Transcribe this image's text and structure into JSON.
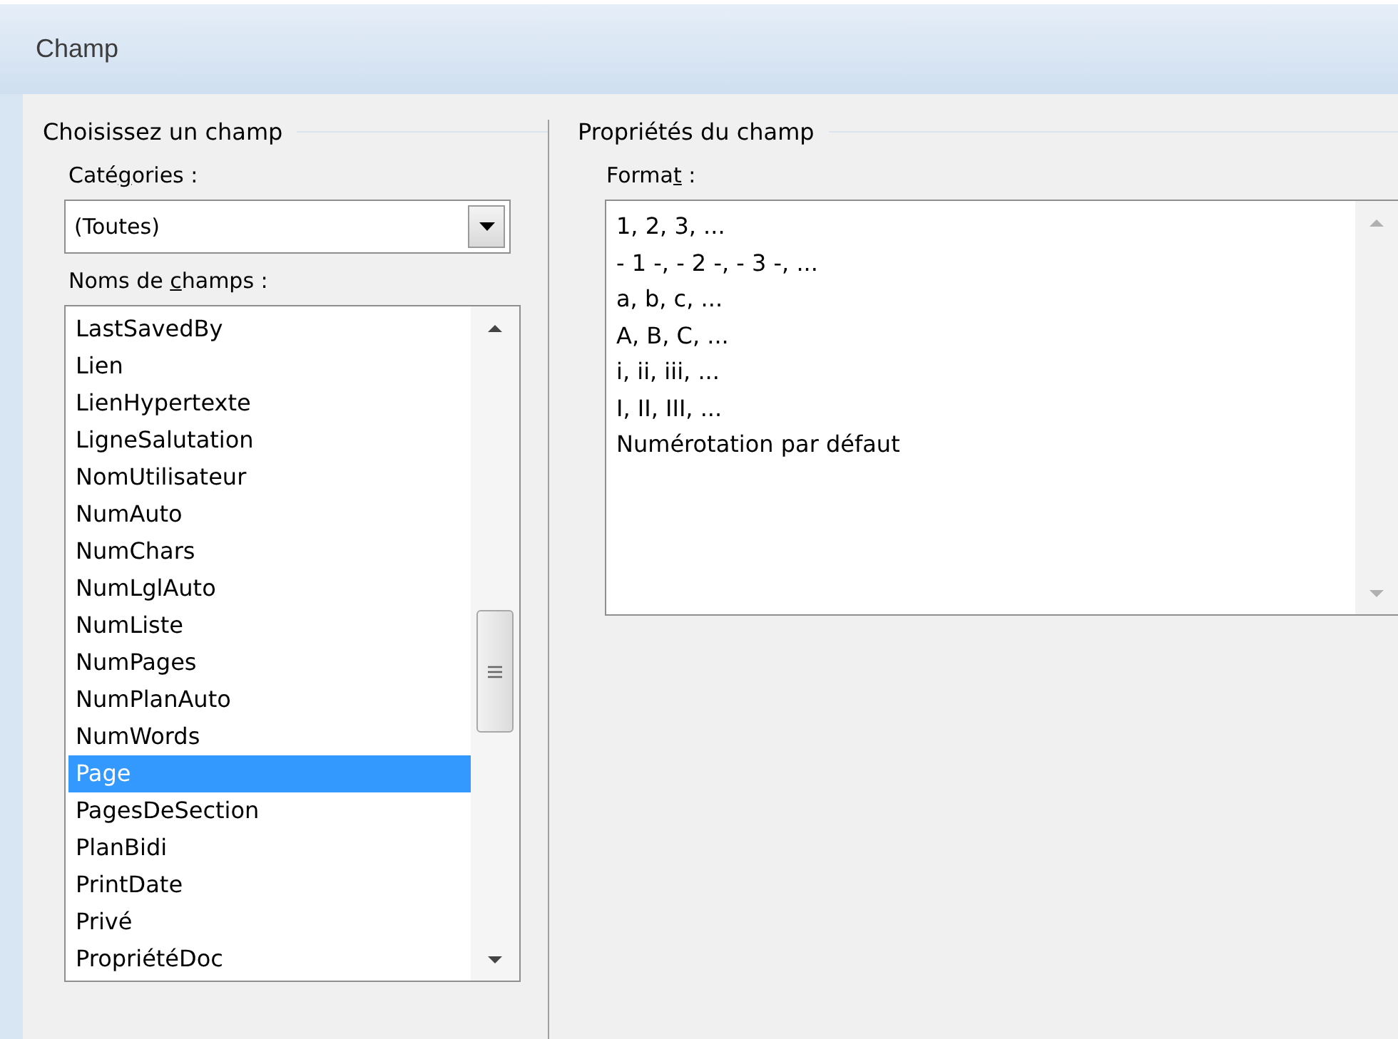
{
  "window": {
    "title": "Champ"
  },
  "left_group": {
    "title": "Choisissez un champ",
    "categories": {
      "label_parts": [
        "Caté",
        "g",
        "ories :"
      ],
      "value": "(Toutes)"
    },
    "field_names": {
      "label_parts": [
        "Noms de ",
        "c",
        "hamps :"
      ],
      "items": [
        {
          "label": "LastSavedBy",
          "selected": false
        },
        {
          "label": "Lien",
          "selected": false
        },
        {
          "label": "LienHypertexte",
          "selected": false
        },
        {
          "label": "LigneSalutation",
          "selected": false
        },
        {
          "label": "NomUtilisateur",
          "selected": false
        },
        {
          "label": "NumAuto",
          "selected": false
        },
        {
          "label": "NumChars",
          "selected": false
        },
        {
          "label": "NumLglAuto",
          "selected": false
        },
        {
          "label": "NumListe",
          "selected": false
        },
        {
          "label": "NumPages",
          "selected": false
        },
        {
          "label": "NumPlanAuto",
          "selected": false
        },
        {
          "label": "NumWords",
          "selected": false
        },
        {
          "label": "Page",
          "selected": true
        },
        {
          "label": "PagesDeSection",
          "selected": false
        },
        {
          "label": "PlanBidi",
          "selected": false
        },
        {
          "label": "PrintDate",
          "selected": false
        },
        {
          "label": "Privé",
          "selected": false
        },
        {
          "label": "PropriétéDoc",
          "selected": false
        }
      ]
    }
  },
  "right_group": {
    "title": "Propriétés du champ",
    "format": {
      "label_parts": [
        "Forma",
        "t",
        " :"
      ],
      "items": [
        {
          "label": "1, 2, 3, ...",
          "selected": false
        },
        {
          "label": "- 1 -, - 2 -, - 3 -, ...",
          "selected": false
        },
        {
          "label": "a, b, c, ...",
          "selected": false
        },
        {
          "label": "A, B, C, ...",
          "selected": false
        },
        {
          "label": "i, ii, iii, ...",
          "selected": false
        },
        {
          "label": "I, II, III, ...",
          "selected": false
        },
        {
          "label": "Numérotation par défaut",
          "selected": false
        }
      ]
    }
  }
}
